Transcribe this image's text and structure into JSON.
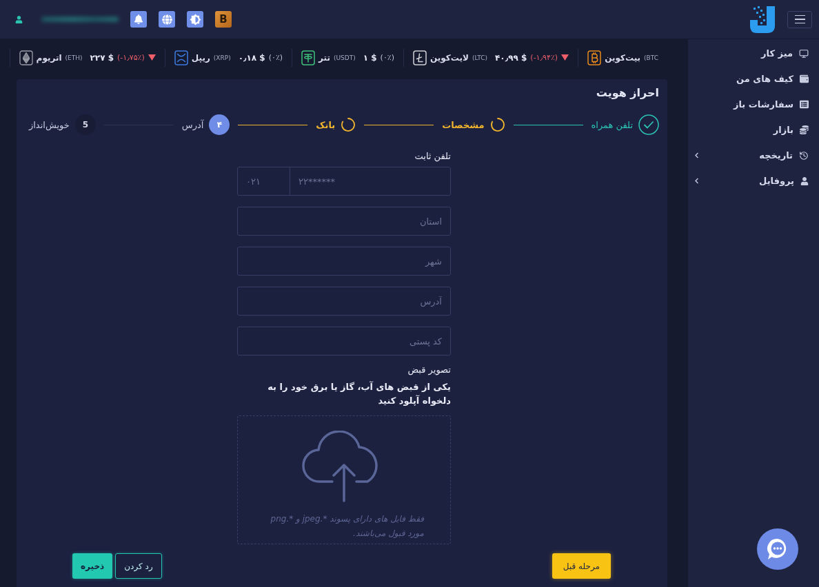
{
  "header": {
    "badge_letter": "B"
  },
  "ticker": [
    {
      "name": "بیت‌کوین",
      "symbol": "(BTC"
    },
    {
      "name": "لایت‌کوین",
      "symbol": "(LTC)",
      "price": "۴۰٫۹۹ $",
      "change": "(-۱٫۹۴٪)",
      "down": true
    },
    {
      "name": "تتر",
      "symbol": "(USDT)",
      "price": "۱ $",
      "change": "(۰٪)",
      "down": false
    },
    {
      "name": "ریپل",
      "symbol": "(XRP)",
      "price": "۰٫۱۸ $",
      "change": "(۰٪)",
      "down": false
    },
    {
      "name": "اتریوم",
      "symbol": "(ETH)",
      "price": "۲۲۷ $",
      "change": "(-۱٫۷۵٪)",
      "down": true
    }
  ],
  "sidebar": {
    "items": [
      {
        "label": "میز کار",
        "expandable": false,
        "selected": false
      },
      {
        "label": "کیف های من",
        "expandable": false,
        "selected": false
      },
      {
        "label": "سفارشات باز",
        "expandable": false,
        "selected": false
      },
      {
        "label": "بازار",
        "expandable": false,
        "selected": false
      },
      {
        "label": "تاریخچه",
        "expandable": true,
        "selected": false
      },
      {
        "label": "پروفایل",
        "expandable": true,
        "selected": false
      }
    ]
  },
  "card": {
    "title": "احراز هویت"
  },
  "stepper": {
    "steps": [
      {
        "label": "تلفن همراه",
        "done": true,
        "in_review": false,
        "selected": false
      },
      {
        "label": "مشخصات",
        "done": false,
        "in_review": true,
        "selected": false
      },
      {
        "label": "بانک",
        "done": false,
        "in_review": true,
        "selected": false
      },
      {
        "label": "آدرس",
        "number": "۴",
        "done": false,
        "in_review": false,
        "selected": true
      },
      {
        "label": "خویش‌انداز",
        "number": "5",
        "done": false,
        "in_review": false,
        "selected": false
      }
    ]
  },
  "form": {
    "phone": {
      "label": "تلفن ثابت",
      "number_placeholder": "۲۲******",
      "area_code_placeholder": "۰۲۱"
    },
    "fields": [
      {
        "placeholder": "استان"
      },
      {
        "placeholder": "شهر"
      },
      {
        "placeholder": "آدرس"
      },
      {
        "placeholder": "کد پستی"
      }
    ],
    "upload": {
      "label": "تصویر قبض",
      "description": "یکی از قبض های آب، گاز یا برق خود را به دلخواه آپلود کنید",
      "hint": "فقط فایل های دارای پسوند *.jpeg و *.png مورد قبول می‌باشند."
    }
  },
  "actions": {
    "previous": "مرحله قبل",
    "cancel": "رد کردن",
    "save": "ذخیره"
  }
}
